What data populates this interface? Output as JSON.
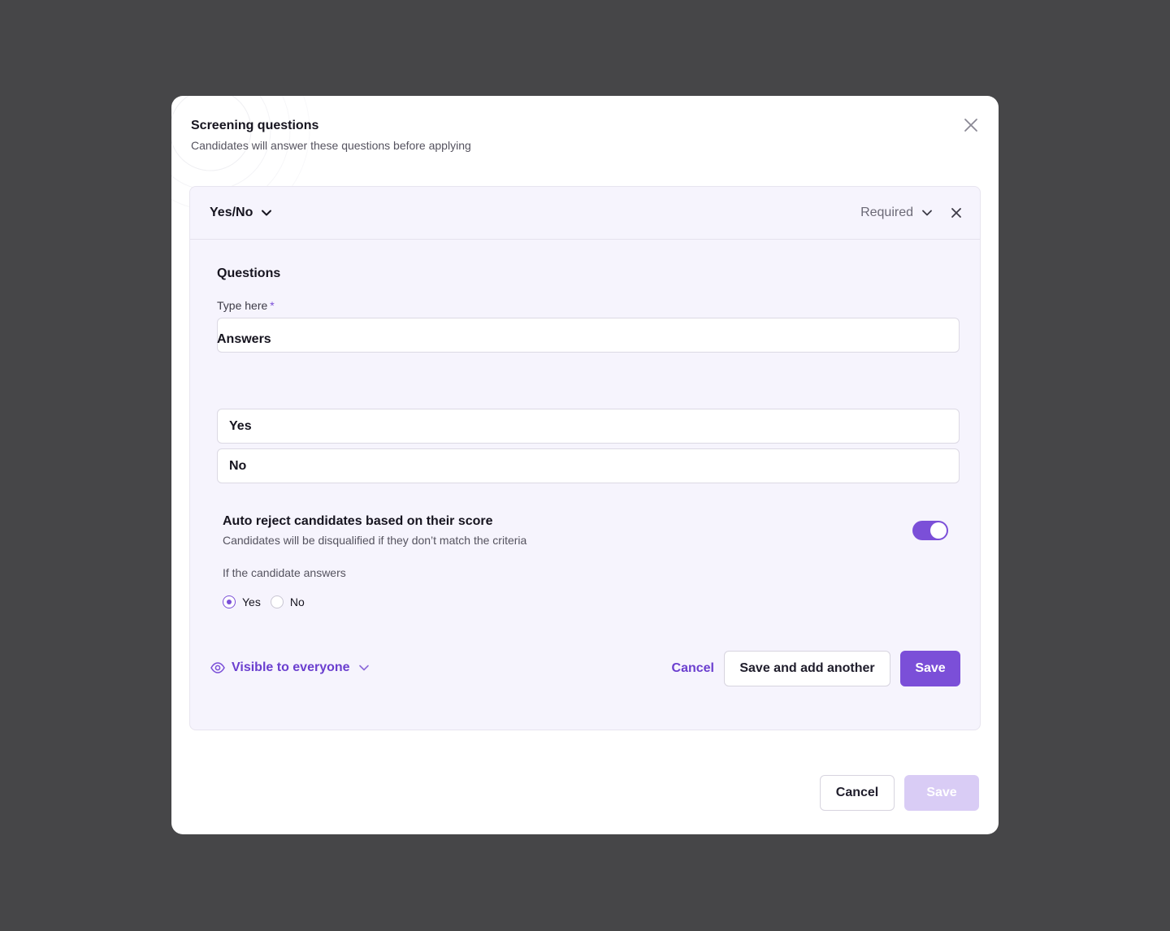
{
  "modal": {
    "title": "Screening questions",
    "subtitle": "Candidates will answer these questions before applying",
    "close_icon": "close-icon"
  },
  "question_card": {
    "type": "Yes/No",
    "required": "Required",
    "questions_title": "Questions",
    "field_label": "Type here",
    "required_mark": "*",
    "question_value": "",
    "answers_title": "Answers",
    "answers": [
      "Yes",
      "No"
    ],
    "auto_reject": {
      "title": "Auto reject candidates based on their score",
      "subtitle": "Candidates will be disqualified if they don’t match the criteria",
      "enabled": true
    },
    "if_label": "If the candidate answers",
    "radio_options": [
      "Yes",
      "No"
    ],
    "selected_option": "Yes",
    "visibility": "Visible to everyone",
    "cancel": "Cancel",
    "save_and_add": "Save and add another",
    "save": "Save"
  },
  "footer": {
    "cancel": "Cancel",
    "save": "Save"
  },
  "colors": {
    "accent": "#7b4fd8",
    "accent_text": "#6b3fcf",
    "disabled": "#d9ccf5",
    "card_bg": "#f6f4fd",
    "backdrop": "#464648"
  }
}
